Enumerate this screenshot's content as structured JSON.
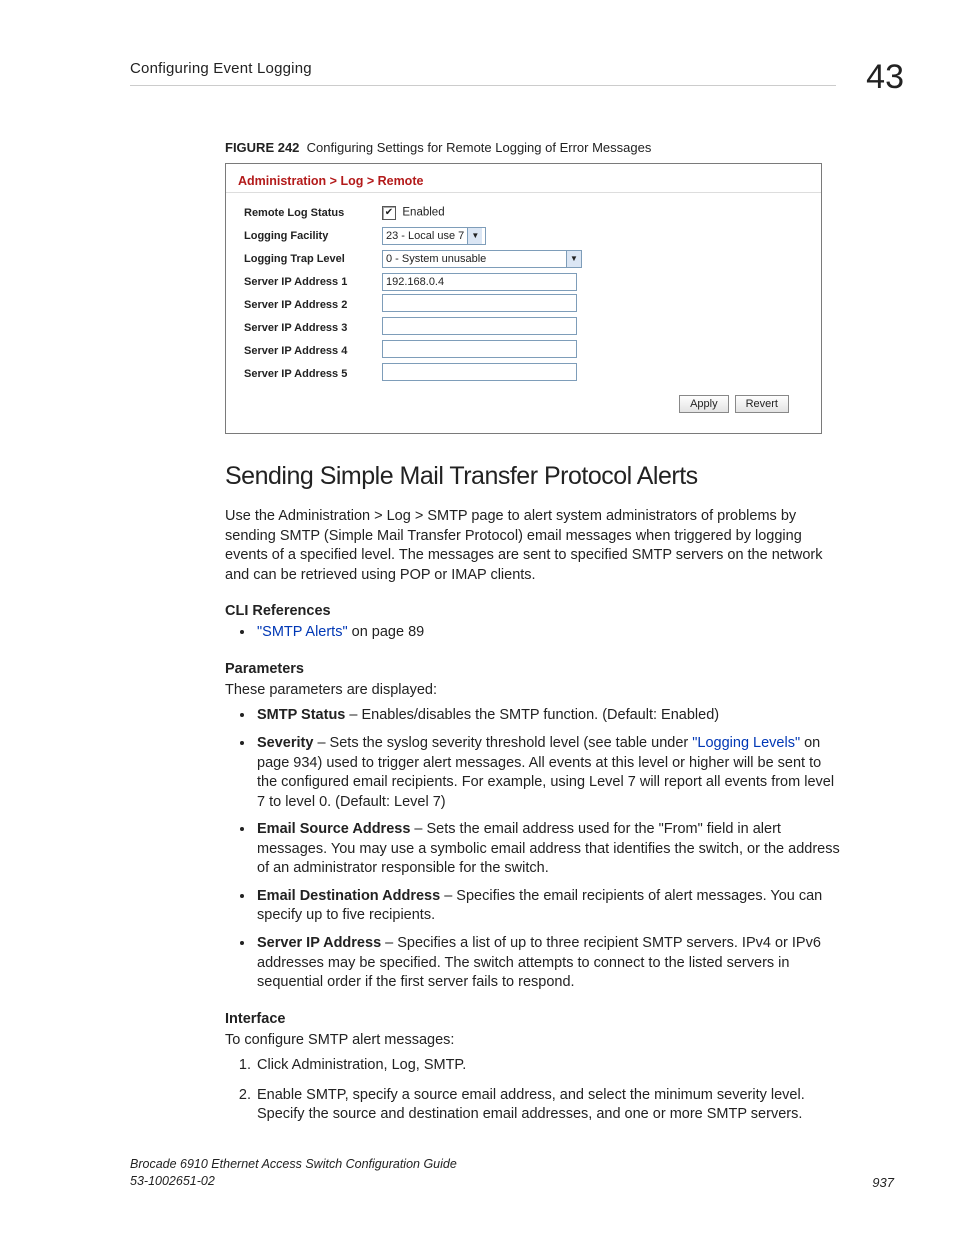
{
  "header": {
    "running_title": "Configuring Event Logging",
    "chapter_number": "43"
  },
  "figure": {
    "label": "FIGURE 242",
    "caption": "Configuring Settings for Remote Logging of Error Messages"
  },
  "form": {
    "breadcrumb": "Administration > Log > Remote",
    "rows": {
      "remote_log_status": {
        "label": "Remote Log Status",
        "checkbox_text": "Enabled",
        "checked": true
      },
      "logging_facility": {
        "label": "Logging Facility",
        "value": "23 - Local use 7"
      },
      "logging_trap_level": {
        "label": "Logging Trap Level",
        "value": "0 - System unusable"
      },
      "ip1": {
        "label": "Server IP Address 1",
        "value": "192.168.0.4"
      },
      "ip2": {
        "label": "Server IP Address 2",
        "value": ""
      },
      "ip3": {
        "label": "Server IP Address 3",
        "value": ""
      },
      "ip4": {
        "label": "Server IP Address 4",
        "value": ""
      },
      "ip5": {
        "label": "Server IP Address 5",
        "value": ""
      }
    },
    "buttons": {
      "apply": "Apply",
      "revert": "Revert"
    }
  },
  "section": {
    "heading": "Sending Simple Mail Transfer Protocol Alerts",
    "intro": "Use the Administration > Log > SMTP page to alert system administrators of problems by sending SMTP (Simple Mail Transfer Protocol) email messages when triggered by logging events of a specified level. The messages are sent to specified SMTP servers on the network and can be retrieved using POP or IMAP clients.",
    "cli_heading": "CLI References",
    "cli_link_text": "\"SMTP Alerts\"",
    "cli_link_tail": " on page 89",
    "params_heading": "Parameters",
    "params_intro": "These parameters are displayed:",
    "params": {
      "smtp_status_term": "SMTP Status",
      "smtp_status_desc": " – Enables/disables the SMTP function. (Default: Enabled)",
      "severity_term": "Severity",
      "severity_pre": " – Sets the syslog severity threshold level (see table under ",
      "severity_link": "\"Logging Levels\"",
      "severity_post": " on page 934) used to trigger alert messages. All events at this level or higher will be sent to the configured email recipients. For example, using Level 7 will report all events from level 7 to level 0. (Default: Level 7)",
      "email_src_term": "Email Source Address",
      "email_src_desc": " – Sets the email address used for the \"From\" field in alert messages. You may use a symbolic email address that identifies the switch, or the address of an administrator responsible for the switch.",
      "email_dst_term": "Email Destination Address",
      "email_dst_desc": " – Specifies the email recipients of alert messages. You can specify up to five recipients.",
      "server_ip_term": "Server IP Address",
      "server_ip_desc": " – Specifies a list of up to three recipient SMTP servers. IPv4 or IPv6 addresses may be specified. The switch attempts to connect to the listed servers in sequential order if the first server fails to respond."
    },
    "interface_heading": "Interface",
    "interface_intro": "To configure SMTP alert messages:",
    "steps": {
      "s1": "Click Administration, Log, SMTP.",
      "s2": "Enable SMTP, specify a source email address, and select the minimum severity level. Specify the source and destination email addresses, and one or more SMTP servers."
    }
  },
  "footer": {
    "doc_title": "Brocade 6910 Ethernet Access Switch Configuration Guide",
    "doc_id": "53-1002651-02",
    "page_number": "937"
  }
}
